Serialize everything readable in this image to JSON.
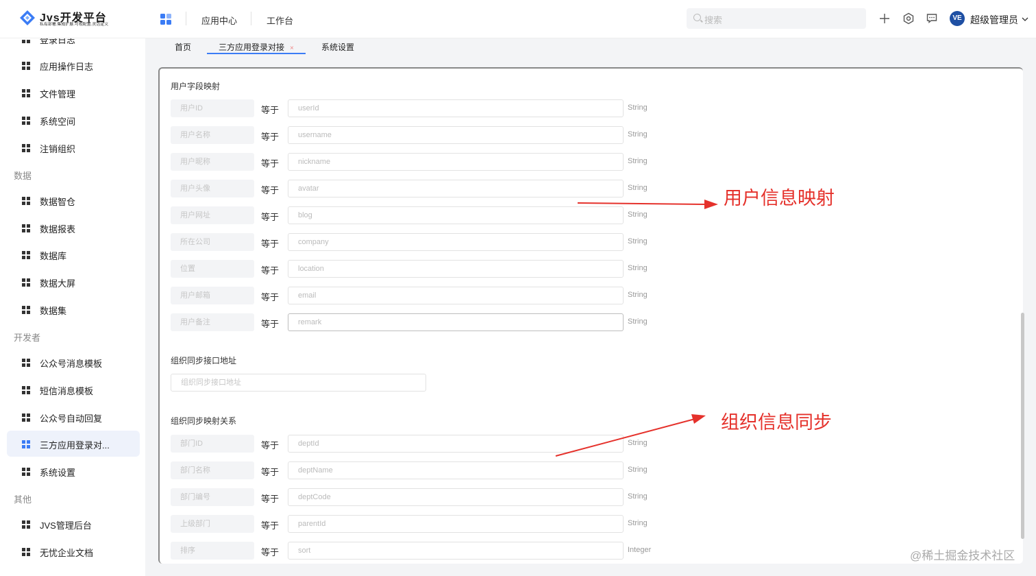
{
  "header": {
    "logo_title": "Jvs开发平台",
    "logo_subtitle": "私有部署.集成扩展.可视配置.灵活定义",
    "nav": [
      "应用中心",
      "工作台"
    ],
    "search_placeholder": "搜索",
    "user_name": "超级管理员",
    "avatar_text": "VE",
    "icons": [
      "plus-icon",
      "settings-icon",
      "message-icon"
    ]
  },
  "sidebar": {
    "items_top": [
      "登录日志",
      "应用操作日志",
      "文件管理",
      "系统空间",
      "注销组织"
    ],
    "group_data": "数据",
    "items_data": [
      "数据智仓",
      "数据报表",
      "数据库",
      "数据大屏",
      "数据集"
    ],
    "group_dev": "开发者",
    "items_dev": [
      "公众号消息模板",
      "短信消息模板",
      "公众号自动回复",
      "三方应用登录对...",
      "系统设置"
    ],
    "group_other": "其他",
    "items_other": [
      "JVS管理后台",
      "无忧企业文档"
    ],
    "active_item": "三方应用登录对..."
  },
  "tabs": [
    {
      "label": "首页"
    },
    {
      "label": "三方应用登录对接",
      "active": true,
      "close": "×"
    },
    {
      "label": "系统设置"
    }
  ],
  "form": {
    "user_section_title": "用户字段映射",
    "equals_label": "等于",
    "user_fields": [
      {
        "label": "用户ID",
        "placeholder": "userId",
        "type": "String"
      },
      {
        "label": "用户名称",
        "placeholder": "username",
        "type": "String"
      },
      {
        "label": "用户昵称",
        "placeholder": "nickname",
        "type": "String"
      },
      {
        "label": "用户头像",
        "placeholder": "avatar",
        "type": "String"
      },
      {
        "label": "用户网址",
        "placeholder": "blog",
        "type": "String"
      },
      {
        "label": "所在公司",
        "placeholder": "company",
        "type": "String"
      },
      {
        "label": "位置",
        "placeholder": "location",
        "type": "String"
      },
      {
        "label": "用户邮箱",
        "placeholder": "email",
        "type": "String"
      },
      {
        "label": "用户备注",
        "placeholder": "remark",
        "type": "String"
      }
    ],
    "sync_url_title": "组织同步接口地址",
    "sync_url_placeholder": "组织同步接口地址",
    "org_section_title": "组织同步映射关系",
    "org_fields": [
      {
        "label": "部门ID",
        "placeholder": "deptId",
        "type": "String"
      },
      {
        "label": "部门名称",
        "placeholder": "deptName",
        "type": "String"
      },
      {
        "label": "部门编号",
        "placeholder": "deptCode",
        "type": "String"
      },
      {
        "label": "上级部门",
        "placeholder": "parentId",
        "type": "String"
      },
      {
        "label": "排序",
        "placeholder": "sort",
        "type": "Integer"
      }
    ]
  },
  "annotations": {
    "user_mapping": "用户信息映射",
    "org_sync": "组织信息同步",
    "color": "#e5312b"
  },
  "credit": "@稀土掘金技术社区",
  "colors": {
    "accent": "#3b7cf5",
    "annotation": "#e5312b"
  }
}
